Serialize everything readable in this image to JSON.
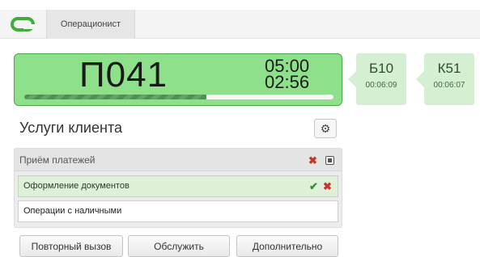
{
  "header": {
    "tab_label": "Операционист"
  },
  "ticket": {
    "number": "П041",
    "time_limit": "05:00",
    "time_elapsed": "02:56",
    "progress": 0.59
  },
  "queue": [
    {
      "id": "Б10",
      "wait": "00:06:09"
    },
    {
      "id": "К51",
      "wait": "00:06:07"
    }
  ],
  "services": {
    "title": "Услуги клиента",
    "group_label": "Приём платежей",
    "items": [
      {
        "label": "Оформление документов",
        "active": true
      },
      {
        "label": "Операции с наличными",
        "active": false
      }
    ]
  },
  "buttons": {
    "recall": "Повторный вызов",
    "serve": "Обслужить",
    "additional": "Дополнительно"
  },
  "icons": {
    "logo": "logo-icon",
    "settings": "gear-icon",
    "remove": "close-icon",
    "confirm": "check-icon",
    "collapse": "collapse-icon"
  },
  "colors": {
    "ticket_bg": "#8fe08a",
    "ticket_border": "#4aa844",
    "queue_card": "#d4efd1",
    "active_row": "#dff0d8",
    "logo_green": "#3fae3a",
    "danger": "#c0392b",
    "success": "#3a8c33"
  }
}
